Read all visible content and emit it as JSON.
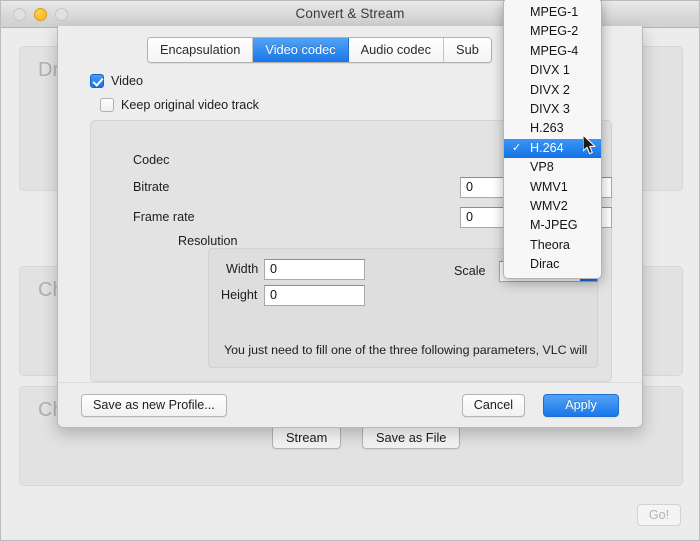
{
  "window": {
    "title": "Convert & Stream",
    "traffic_lights": [
      "close-button",
      "minimize-button",
      "zoom-button"
    ],
    "background_panels": [
      {
        "label": "Dr"
      },
      {
        "label": "Ch"
      },
      {
        "label": "Ch"
      }
    ],
    "go_button": "Go!",
    "bottom_buttons": [
      {
        "label": "Stream"
      },
      {
        "label": "Save as File"
      }
    ]
  },
  "sheet": {
    "tabs": [
      {
        "label": "Encapsulation",
        "active": false
      },
      {
        "label": "Video codec",
        "active": true
      },
      {
        "label": "Audio codec",
        "active": false
      },
      {
        "label": "Sub",
        "active": false
      }
    ],
    "checkboxes": [
      {
        "label": "Video",
        "checked": true
      },
      {
        "label": "Keep original video track",
        "checked": false
      }
    ],
    "fields": {
      "codec_label": "Codec",
      "bitrate_label": "Bitrate",
      "bitrate_value": "0",
      "framerate_label": "Frame rate",
      "framerate_value": "0",
      "resolution_label": "Resolution",
      "width_label": "Width",
      "width_value": "0",
      "height_label": "Height",
      "height_value": "0",
      "scale_label": "Scale",
      "scale_value": ""
    },
    "hint": "You just need to fill one of the three following parameters, VLC will",
    "footer": {
      "save_profile": "Save as new Profile...",
      "cancel": "Cancel",
      "apply": "Apply"
    }
  },
  "codec_menu": {
    "selected": "H.264",
    "items": [
      "MPEG-1",
      "MPEG-2",
      "MPEG-4",
      "DIVX 1",
      "DIVX 2",
      "DIVX 3",
      "H.263",
      "H.264",
      "VP8",
      "WMV1",
      "WMV2",
      "M-JPEG",
      "Theora",
      "Dirac"
    ]
  },
  "colors": {
    "accent_blue": "#1877e8",
    "selection_blue": "#1471e6",
    "minimize_yellow": "#f6b416",
    "window_bg": "#ececec",
    "sheet_bg": "#ededed"
  }
}
